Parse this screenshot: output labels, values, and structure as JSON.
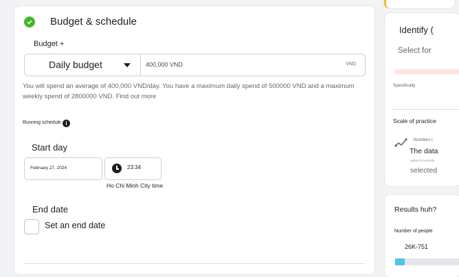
{
  "main": {
    "section_title": "Budget & schedule",
    "budget_label": "Budget +",
    "budget_type": "Daily budget",
    "budget_amount": "400,000 VND",
    "currency": "VND",
    "spend_info": "You will spend an average of 400,000 VND/day. You have a maximum daily spend of 500000 VND and a maximum weekly spend of 2800000 VND.",
    "find_out_more": "Find out more",
    "running_schedule_label": "Running schedule",
    "info_glyph": "i",
    "start_day_label": "Start day",
    "start_date": "February 27, 2024",
    "start_time": "23:34",
    "timezone": "Ho Chi Minh City time",
    "end_date_label": "End date",
    "set_end_date_label": "Set an end date"
  },
  "side_panel": {
    "identify_title": "Identify (",
    "select_for": "Select for",
    "specifically": "Specifically",
    "scale_label": "Scale of practice",
    "numbers_text": "Numbers I",
    "the_data": "The data",
    "option_text": "option is currently",
    "selected_text": "selected"
  },
  "results_panel": {
    "title": "Results huh?",
    "people_label": "Number of people",
    "range_value": "26K-751",
    "range_fill_fraction": 0.15
  },
  "colors": {
    "success": "#42b72a",
    "progress_fill": "#58c0e8",
    "warning_accent": "#f7b928"
  },
  "icons": [
    "check-circle-icon",
    "caret-down-icon",
    "info-icon",
    "clock-icon",
    "trend-line-icon"
  ]
}
